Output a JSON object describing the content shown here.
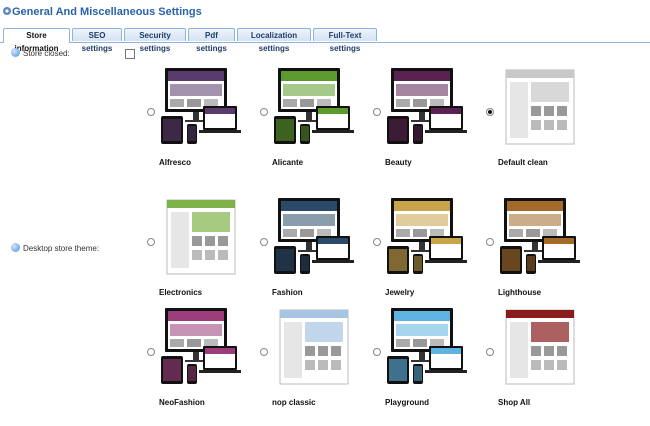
{
  "page_title": "General And Miscellaneous Settings",
  "tabs": [
    {
      "label": "Store information",
      "active": true
    },
    {
      "label": "SEO settings",
      "active": false
    },
    {
      "label": "Security settings",
      "active": false
    },
    {
      "label": "Pdf settings",
      "active": false
    },
    {
      "label": "Localization settings",
      "active": false
    },
    {
      "label": "Full-Text settings",
      "active": false
    }
  ],
  "fields": {
    "store_closed_label": "Store closed:",
    "store_closed_checked": false,
    "desktop_theme_label": "Desktop store theme:"
  },
  "themes": [
    {
      "name": "Alfresco",
      "selected": false,
      "accent": "#5a3b6e"
    },
    {
      "name": "Alicante",
      "selected": false,
      "accent": "#5b9a2c"
    },
    {
      "name": "Beauty",
      "selected": false,
      "accent": "#5b2150"
    },
    {
      "name": "Default clean",
      "selected": true,
      "accent": "#c8c8c8"
    },
    {
      "name": "Electronics",
      "selected": false,
      "accent": "#7fb34a"
    },
    {
      "name": "Fashion",
      "selected": false,
      "accent": "#2b4a6a"
    },
    {
      "name": "Jewelry",
      "selected": false,
      "accent": "#c9a44a"
    },
    {
      "name": "Lighthouse",
      "selected": false,
      "accent": "#a36a2a"
    },
    {
      "name": "NeoFashion",
      "selected": false,
      "accent": "#9a3d7a"
    },
    {
      "name": "nop classic",
      "selected": false,
      "accent": "#a7c4e2"
    },
    {
      "name": "Playground",
      "selected": false,
      "accent": "#5fb3e0"
    },
    {
      "name": "Shop All",
      "selected": false,
      "accent": "#8a1c1c"
    }
  ]
}
